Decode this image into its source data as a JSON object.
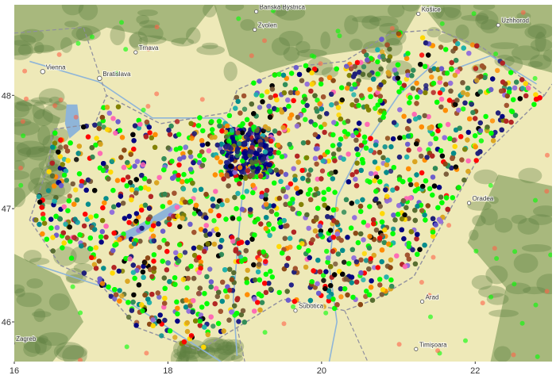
{
  "map": {
    "x_range": [
      16,
      23
    ],
    "y_range": [
      45.65,
      48.8
    ],
    "x_ticks": [
      {
        "value": 16,
        "label": "16"
      },
      {
        "value": 18,
        "label": "18"
      },
      {
        "value": 20,
        "label": "20"
      },
      {
        "value": 22,
        "label": "22"
      }
    ],
    "y_ticks": [
      {
        "value": 46,
        "label": "46"
      },
      {
        "value": 47,
        "label": "47"
      },
      {
        "value": 48,
        "label": "48"
      }
    ],
    "places": [
      {
        "name": "Banská Bystrica",
        "lon": 19.15,
        "lat": 48.74,
        "size": "small"
      },
      {
        "name": "Zvolen",
        "lon": 19.13,
        "lat": 48.58,
        "size": "small"
      },
      {
        "name": "Košice",
        "lon": 21.26,
        "lat": 48.72,
        "size": "small"
      },
      {
        "name": "Uzhhorod",
        "lon": 22.3,
        "lat": 48.62,
        "size": "small"
      },
      {
        "name": "Trnava",
        "lon": 17.58,
        "lat": 48.38,
        "size": "small"
      },
      {
        "name": "Vienna",
        "lon": 16.37,
        "lat": 48.21,
        "size": "large"
      },
      {
        "name": "Bratislava",
        "lon": 17.11,
        "lat": 48.15,
        "size": "large"
      },
      {
        "name": "Oradea",
        "lon": 21.92,
        "lat": 47.05,
        "size": "small"
      },
      {
        "name": "Arad",
        "lon": 21.31,
        "lat": 46.18,
        "size": "small"
      },
      {
        "name": "Subotica",
        "lon": 19.66,
        "lat": 46.1,
        "size": "small"
      },
      {
        "name": "Zagreb",
        "lon": 15.98,
        "lat": 45.81,
        "size": "small"
      },
      {
        "name": "Timișoara",
        "lon": 21.23,
        "lat": 45.76,
        "size": "small"
      }
    ],
    "point_colors": [
      "#00ff00",
      "#00ff00",
      "#00ff00",
      "#00ff00",
      "#000080",
      "#1f1f7a",
      "#8b4513",
      "#7a5c3a",
      "#ff8c00",
      "#ff0000",
      "#b22222",
      "#008b8b",
      "#20b2aa",
      "#ffd700",
      "#daa520",
      "#9370db",
      "#6a5acd",
      "#808000",
      "#556b2f",
      "#ff69b4",
      "#a0522d",
      "#000000",
      "#2e8b57"
    ],
    "colors": {
      "land": "#eee9b8",
      "forest": "#6f8f4c",
      "water": "#8fb5d8",
      "border": "#8f8f9f"
    }
  }
}
